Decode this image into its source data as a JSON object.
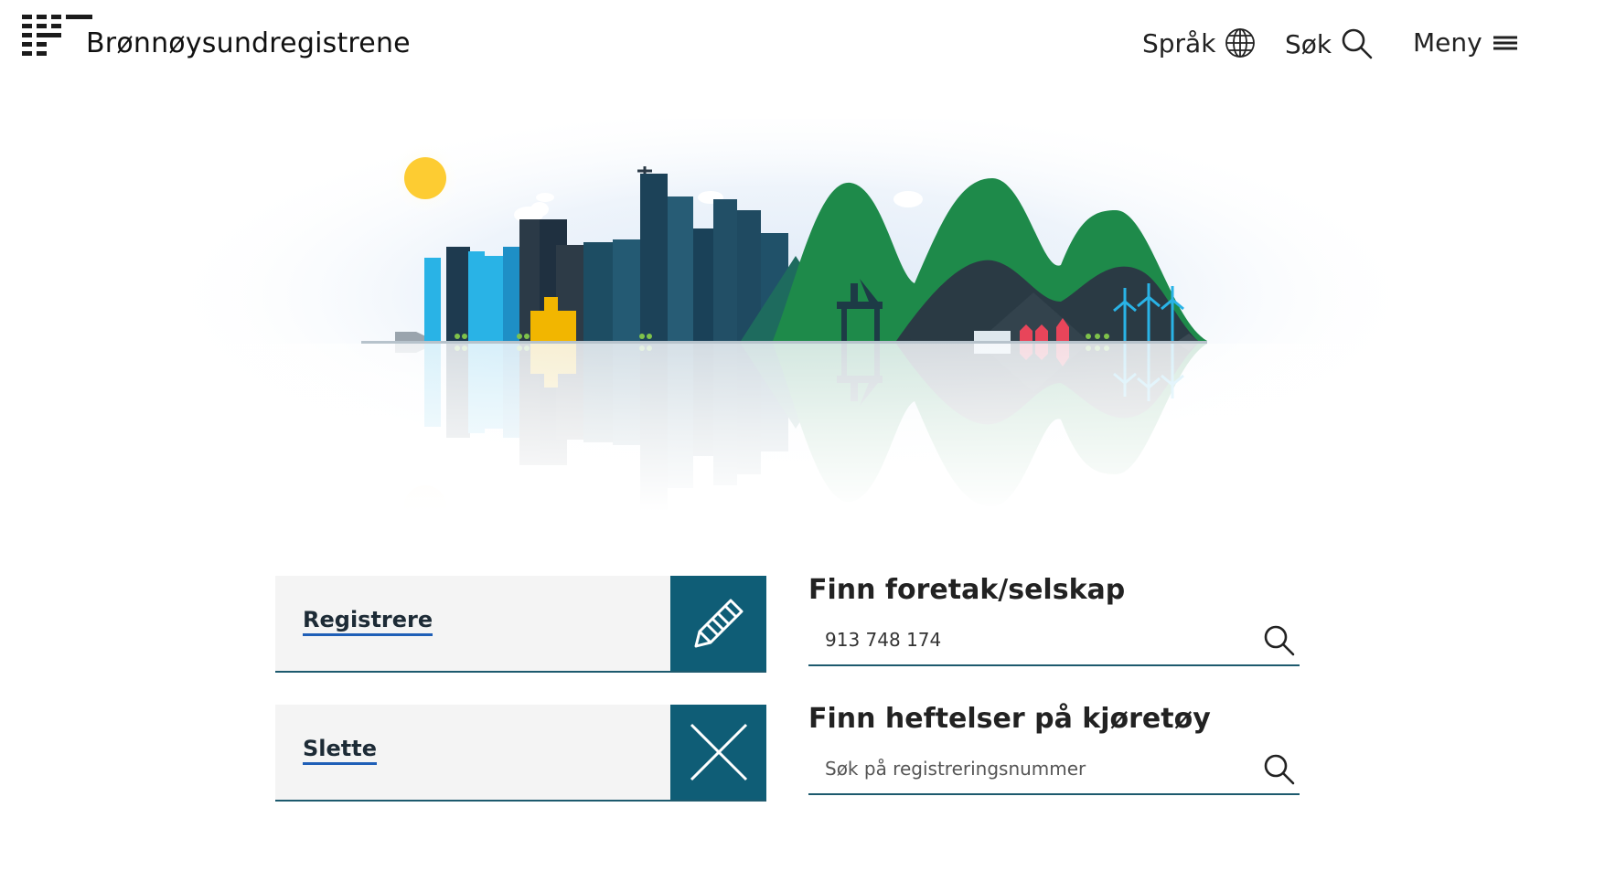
{
  "header": {
    "logo_text": "Brønnøysundregistrene",
    "nav": {
      "language_label": "Språk",
      "search_label": "Søk",
      "menu_label": "Meny"
    }
  },
  "actions": {
    "register_label": "Registrere",
    "delete_label": "Slette"
  },
  "search_company": {
    "title": "Finn foretak/selskap",
    "value": "913 748 174",
    "placeholder": ""
  },
  "search_vehicle": {
    "title": "Finn heftelser på kjøretøy",
    "value": "",
    "placeholder": "Søk på registreringsnummer"
  },
  "colors": {
    "accent": "#0f5d76",
    "link_underline": "#1f5fb7"
  },
  "icons": [
    "globe-icon",
    "search-icon",
    "menu-icon",
    "pencil-icon",
    "close-icon"
  ]
}
